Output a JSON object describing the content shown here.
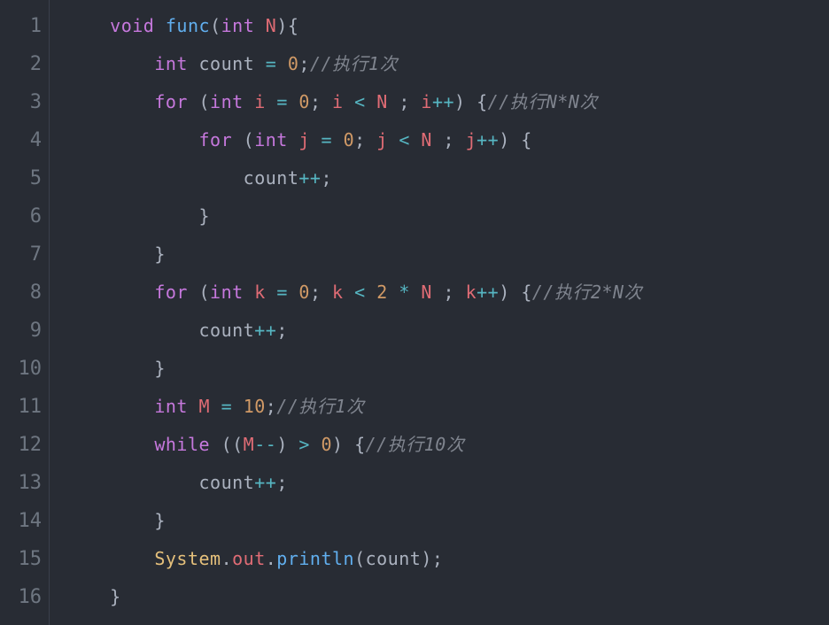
{
  "editor": {
    "language": "java",
    "theme": "one-dark",
    "line_count": 16,
    "gutter": [
      "1",
      "2",
      "3",
      "4",
      "5",
      "6",
      "7",
      "8",
      "9",
      "10",
      "11",
      "12",
      "13",
      "14",
      "15",
      "16"
    ],
    "lines": [
      {
        "indent": "    ",
        "tokens": [
          {
            "t": "void ",
            "c": "keyword"
          },
          {
            "t": "func",
            "c": "func"
          },
          {
            "t": "(",
            "c": "paren"
          },
          {
            "t": "int ",
            "c": "type"
          },
          {
            "t": "N",
            "c": "ident"
          },
          {
            "t": ")",
            "c": "paren"
          },
          {
            "t": "{",
            "c": "punct"
          }
        ]
      },
      {
        "indent": "        ",
        "tokens": [
          {
            "t": "int ",
            "c": "type"
          },
          {
            "t": "count",
            "c": "var"
          },
          {
            "t": " ",
            "c": "plain"
          },
          {
            "t": "=",
            "c": "op"
          },
          {
            "t": " ",
            "c": "plain"
          },
          {
            "t": "0",
            "c": "num"
          },
          {
            "t": ";",
            "c": "punct"
          },
          {
            "t": "//执行1次",
            "c": "comment"
          }
        ]
      },
      {
        "indent": "        ",
        "tokens": [
          {
            "t": "for ",
            "c": "keyword"
          },
          {
            "t": "(",
            "c": "paren"
          },
          {
            "t": "int ",
            "c": "type"
          },
          {
            "t": "i",
            "c": "ident"
          },
          {
            "t": " ",
            "c": "plain"
          },
          {
            "t": "=",
            "c": "op"
          },
          {
            "t": " ",
            "c": "plain"
          },
          {
            "t": "0",
            "c": "num"
          },
          {
            "t": "; ",
            "c": "punct"
          },
          {
            "t": "i",
            "c": "ident"
          },
          {
            "t": " ",
            "c": "plain"
          },
          {
            "t": "<",
            "c": "op"
          },
          {
            "t": " ",
            "c": "plain"
          },
          {
            "t": "N",
            "c": "ident"
          },
          {
            "t": " ; ",
            "c": "punct"
          },
          {
            "t": "i",
            "c": "ident"
          },
          {
            "t": "++",
            "c": "op"
          },
          {
            "t": ") {",
            "c": "punct"
          },
          {
            "t": "//执行N*N次",
            "c": "comment"
          }
        ]
      },
      {
        "indent": "            ",
        "tokens": [
          {
            "t": "for ",
            "c": "keyword"
          },
          {
            "t": "(",
            "c": "paren"
          },
          {
            "t": "int ",
            "c": "type"
          },
          {
            "t": "j",
            "c": "ident"
          },
          {
            "t": " ",
            "c": "plain"
          },
          {
            "t": "=",
            "c": "op"
          },
          {
            "t": " ",
            "c": "plain"
          },
          {
            "t": "0",
            "c": "num"
          },
          {
            "t": "; ",
            "c": "punct"
          },
          {
            "t": "j",
            "c": "ident"
          },
          {
            "t": " ",
            "c": "plain"
          },
          {
            "t": "<",
            "c": "op"
          },
          {
            "t": " ",
            "c": "plain"
          },
          {
            "t": "N",
            "c": "ident"
          },
          {
            "t": " ; ",
            "c": "punct"
          },
          {
            "t": "j",
            "c": "ident"
          },
          {
            "t": "++",
            "c": "op"
          },
          {
            "t": ") {",
            "c": "punct"
          }
        ]
      },
      {
        "indent": "                ",
        "tokens": [
          {
            "t": "count",
            "c": "var"
          },
          {
            "t": "++",
            "c": "op"
          },
          {
            "t": ";",
            "c": "punct"
          }
        ]
      },
      {
        "indent": "            ",
        "tokens": [
          {
            "t": "}",
            "c": "punct"
          }
        ]
      },
      {
        "indent": "        ",
        "tokens": [
          {
            "t": "}",
            "c": "punct"
          }
        ]
      },
      {
        "indent": "        ",
        "tokens": [
          {
            "t": "for ",
            "c": "keyword"
          },
          {
            "t": "(",
            "c": "paren"
          },
          {
            "t": "int ",
            "c": "type"
          },
          {
            "t": "k",
            "c": "ident"
          },
          {
            "t": " ",
            "c": "plain"
          },
          {
            "t": "=",
            "c": "op"
          },
          {
            "t": " ",
            "c": "plain"
          },
          {
            "t": "0",
            "c": "num"
          },
          {
            "t": "; ",
            "c": "punct"
          },
          {
            "t": "k",
            "c": "ident"
          },
          {
            "t": " ",
            "c": "plain"
          },
          {
            "t": "<",
            "c": "op"
          },
          {
            "t": " ",
            "c": "plain"
          },
          {
            "t": "2",
            "c": "num"
          },
          {
            "t": " ",
            "c": "plain"
          },
          {
            "t": "*",
            "c": "op"
          },
          {
            "t": " ",
            "c": "plain"
          },
          {
            "t": "N",
            "c": "ident"
          },
          {
            "t": " ; ",
            "c": "punct"
          },
          {
            "t": "k",
            "c": "ident"
          },
          {
            "t": "++",
            "c": "op"
          },
          {
            "t": ") {",
            "c": "punct"
          },
          {
            "t": "//执行2*N次",
            "c": "comment"
          }
        ]
      },
      {
        "indent": "            ",
        "tokens": [
          {
            "t": "count",
            "c": "var"
          },
          {
            "t": "++",
            "c": "op"
          },
          {
            "t": ";",
            "c": "punct"
          }
        ]
      },
      {
        "indent": "        ",
        "tokens": [
          {
            "t": "}",
            "c": "punct"
          }
        ]
      },
      {
        "indent": "        ",
        "tokens": [
          {
            "t": "int ",
            "c": "type"
          },
          {
            "t": "M",
            "c": "ident"
          },
          {
            "t": " ",
            "c": "plain"
          },
          {
            "t": "=",
            "c": "op"
          },
          {
            "t": " ",
            "c": "plain"
          },
          {
            "t": "10",
            "c": "num"
          },
          {
            "t": ";",
            "c": "punct"
          },
          {
            "t": "//执行1次",
            "c": "comment"
          }
        ]
      },
      {
        "indent": "        ",
        "tokens": [
          {
            "t": "while ",
            "c": "keyword"
          },
          {
            "t": "((",
            "c": "paren"
          },
          {
            "t": "M",
            "c": "ident"
          },
          {
            "t": "--",
            "c": "op"
          },
          {
            "t": ") ",
            "c": "paren"
          },
          {
            "t": ">",
            "c": "op"
          },
          {
            "t": " ",
            "c": "plain"
          },
          {
            "t": "0",
            "c": "num"
          },
          {
            "t": ") {",
            "c": "punct"
          },
          {
            "t": "//执行10次",
            "c": "comment"
          }
        ]
      },
      {
        "indent": "            ",
        "tokens": [
          {
            "t": "count",
            "c": "var"
          },
          {
            "t": "++",
            "c": "op"
          },
          {
            "t": ";",
            "c": "punct"
          }
        ]
      },
      {
        "indent": "        ",
        "tokens": [
          {
            "t": "}",
            "c": "punct"
          }
        ]
      },
      {
        "indent": "        ",
        "tokens": [
          {
            "t": "System",
            "c": "class"
          },
          {
            "t": ".",
            "c": "punct"
          },
          {
            "t": "out",
            "c": "ident"
          },
          {
            "t": ".",
            "c": "punct"
          },
          {
            "t": "println",
            "c": "func"
          },
          {
            "t": "(",
            "c": "paren"
          },
          {
            "t": "count",
            "c": "var"
          },
          {
            "t": ");",
            "c": "punct"
          }
        ]
      },
      {
        "indent": "    ",
        "tokens": [
          {
            "t": "}",
            "c": "punct"
          }
        ]
      }
    ]
  }
}
